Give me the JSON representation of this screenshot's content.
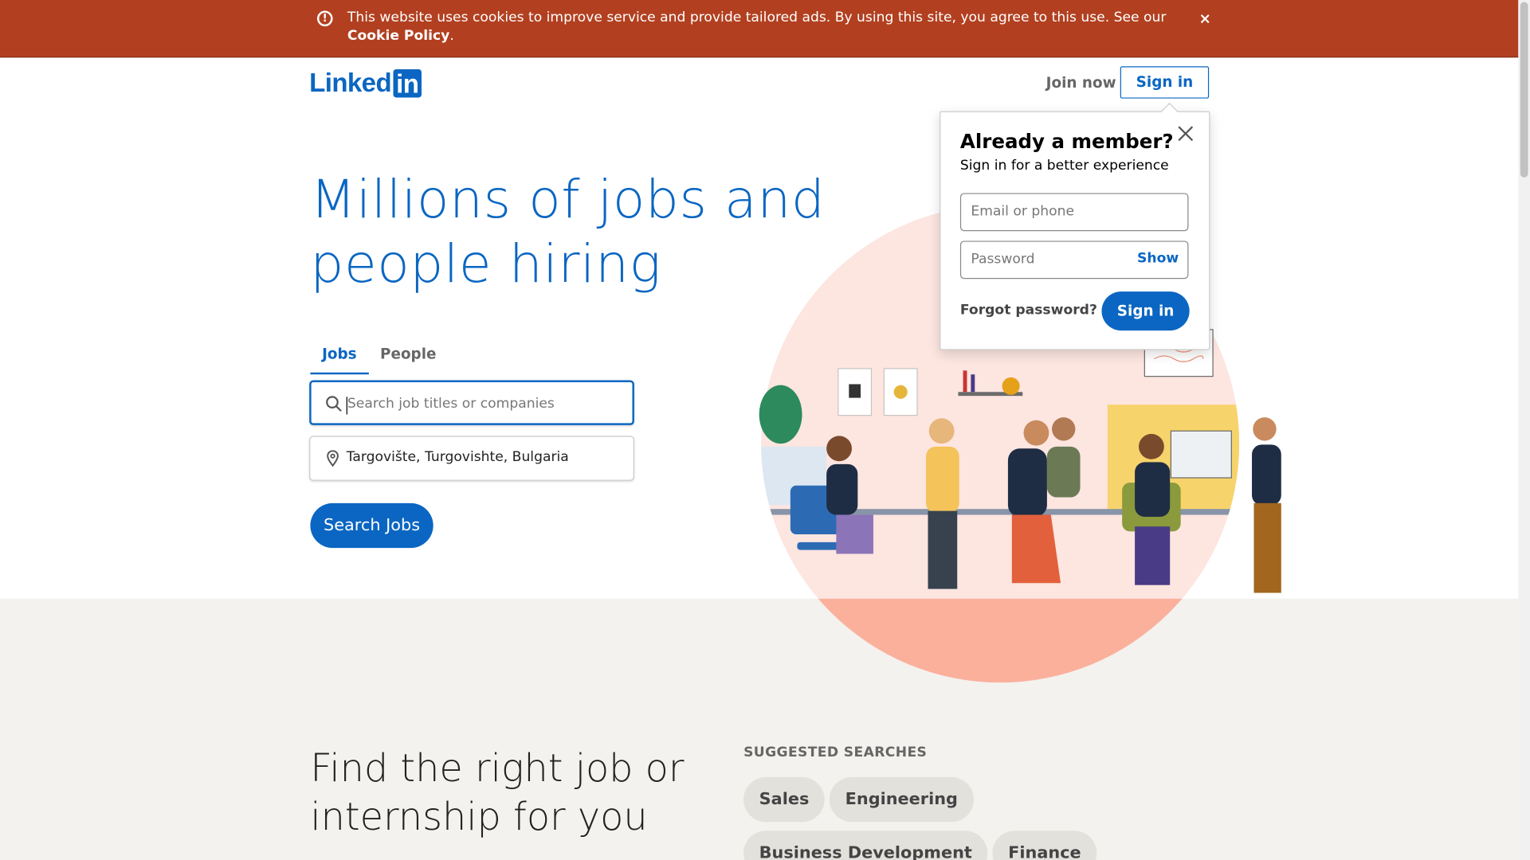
{
  "cookie_banner": {
    "message": "This website uses cookies to improve service and provide tailored ads. By using this site, you agree to this use. See our",
    "link": "Cookie Policy",
    "period": ".",
    "warn_glyph": "!",
    "close_glyph": "×"
  },
  "header": {
    "logo_text": "Linked",
    "logo_box": "in",
    "join_now": "Join now",
    "sign_in": "Sign in"
  },
  "hero": {
    "title": "Millions of jobs and people hiring",
    "tabs": [
      {
        "label": "Jobs",
        "active": true
      },
      {
        "label": "People",
        "active": false
      }
    ],
    "search_placeholder": "Search job titles or companies",
    "location_value": "Targovište, Turgovishte, Bulgaria",
    "search_button": "Search Jobs"
  },
  "signin_popup": {
    "title": "Already a member?",
    "subtitle": "Sign in for a better experience",
    "email_placeholder": "Email or phone",
    "password_placeholder": "Password",
    "show_label": "Show",
    "forgot": "Forgot password?",
    "sign_in": "Sign in"
  },
  "lower": {
    "title": "Find the right job or internship for you",
    "suggested_label": "SUGGESTED SEARCHES",
    "chips": [
      "Sales",
      "Engineering",
      "Business Development",
      "Finance"
    ]
  },
  "colors": {
    "brand": "#0a66c2",
    "cookie_bg": "#b24020",
    "illustration_circle": "#fde5e0",
    "illustration_lower": "#fbb09c"
  }
}
